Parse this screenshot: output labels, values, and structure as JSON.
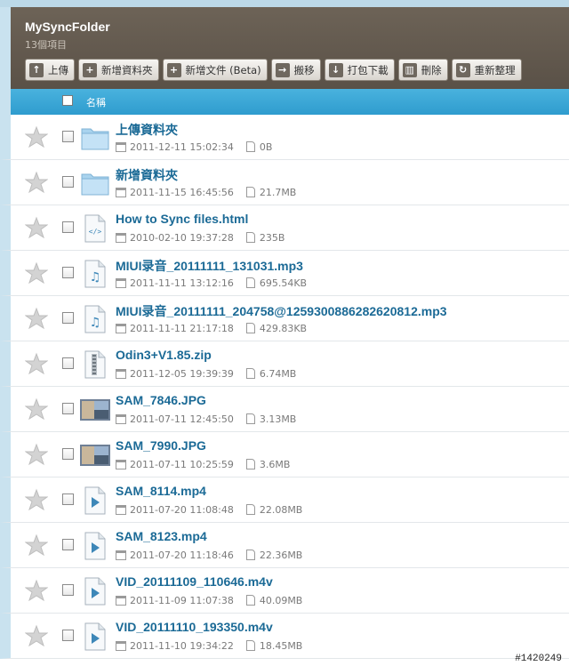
{
  "folder": {
    "title": "MySyncFolder",
    "count": "13個項目"
  },
  "toolbar": [
    {
      "label": "上傳",
      "icon": "upload-icon",
      "glyph": "↑"
    },
    {
      "label": "新增資料夾",
      "icon": "new-folder-icon",
      "glyph": "+"
    },
    {
      "label": "新增文件 (Beta)",
      "icon": "new-document-icon",
      "glyph": "+"
    },
    {
      "label": "搬移",
      "icon": "move-icon",
      "glyph": "→"
    },
    {
      "label": "打包下載",
      "icon": "download-zip-icon",
      "glyph": "↓"
    },
    {
      "label": "刪除",
      "icon": "trash-icon",
      "glyph": "▥"
    },
    {
      "label": "重新整理",
      "icon": "refresh-icon",
      "glyph": "↻"
    }
  ],
  "list_header": {
    "name_label": "名稱"
  },
  "files": [
    {
      "name": "上傳資料夾",
      "date": "2011-12-11 15:02:34",
      "size": "0B",
      "type": "folder"
    },
    {
      "name": "新增資料夾",
      "date": "2011-11-15 16:45:56",
      "size": "21.7MB",
      "type": "folder"
    },
    {
      "name": "How to Sync files.html",
      "date": "2010-02-10 19:37:28",
      "size": "235B",
      "type": "html"
    },
    {
      "name": "MIUI录音_20111111_131031.mp3",
      "date": "2011-11-11 13:12:16",
      "size": "695.54KB",
      "type": "audio"
    },
    {
      "name": "MIUI录音_20111111_204758@1259300886282620812.mp3",
      "date": "2011-11-11 21:17:18",
      "size": "429.83KB",
      "type": "audio"
    },
    {
      "name": "Odin3+V1.85.zip",
      "date": "2011-12-05 19:39:39",
      "size": "6.74MB",
      "type": "zip"
    },
    {
      "name": "SAM_7846.JPG",
      "date": "2011-07-11 12:45:50",
      "size": "3.13MB",
      "type": "image"
    },
    {
      "name": "SAM_7990.JPG",
      "date": "2011-07-11 10:25:59",
      "size": "3.6MB",
      "type": "image"
    },
    {
      "name": "SAM_8114.mp4",
      "date": "2011-07-20 11:08:48",
      "size": "22.08MB",
      "type": "video"
    },
    {
      "name": "SAM_8123.mp4",
      "date": "2011-07-20 11:18:46",
      "size": "22.36MB",
      "type": "video"
    },
    {
      "name": "VID_20111109_110646.m4v",
      "date": "2011-11-09 11:07:38",
      "size": "40.09MB",
      "type": "video"
    },
    {
      "name": "VID_20111110_193350.m4v",
      "date": "2011-11-10 19:34:22",
      "size": "18.45MB",
      "type": "video"
    }
  ],
  "watermark": "#1420249",
  "colors": {
    "header_bg": "#5f564b",
    "list_header_bg": "#3aa6d6",
    "link": "#1b6a96",
    "side_strip": "#c9e2ef"
  }
}
